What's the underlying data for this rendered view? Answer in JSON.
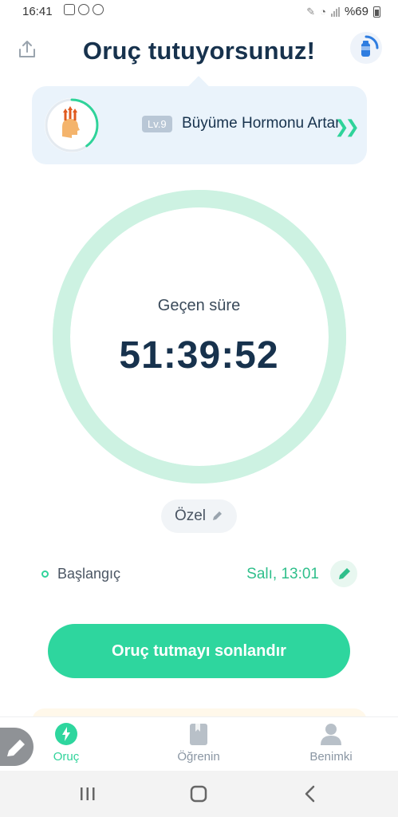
{
  "status_bar": {
    "time": "16:41",
    "battery": "%69"
  },
  "header": {
    "title": "Oruç tutuyorsunuz!",
    "share_icon": "share-icon",
    "water_icon": "water-bottle-icon"
  },
  "badge": {
    "level": "Lv.9",
    "title": "Büyüme Hormonu Artar",
    "progress_fraction": 0.4
  },
  "timer": {
    "label": "Geçen süre",
    "value": "51:39:52",
    "progress_fraction": 1.0
  },
  "fast_type": {
    "label": "Özel"
  },
  "start": {
    "label": "Başlangıç",
    "value": "Salı, 13:01"
  },
  "action": {
    "end_label": "Oruç tutmayı sonlandır"
  },
  "nav": {
    "items": [
      {
        "label": "Oruç",
        "icon": "bolt-icon",
        "active": true
      },
      {
        "label": "Öğrenin",
        "icon": "book-icon",
        "active": false
      },
      {
        "label": "Benimki",
        "icon": "person-icon",
        "active": false
      }
    ]
  },
  "colors": {
    "accent": "#2ed69e",
    "ring": "#d8f6ea",
    "title": "#17324d"
  }
}
